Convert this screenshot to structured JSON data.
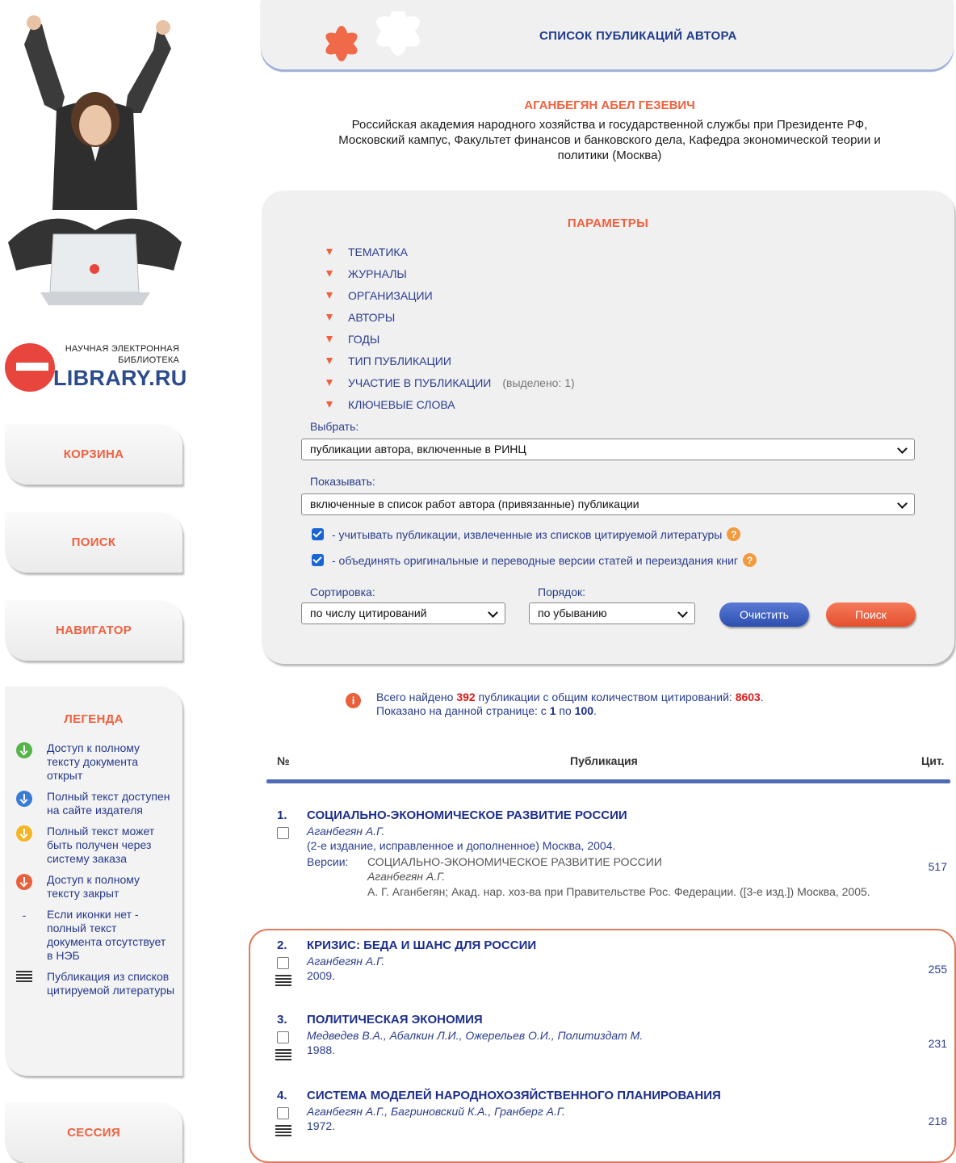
{
  "header": {
    "title": "СПИСОК ПУБЛИКАЦИЙ АВТОРА"
  },
  "logo": {
    "tagline_line1": "НАУЧНАЯ ЭЛЕКТРОННАЯ",
    "tagline_line2": "БИБЛИОТЕКА",
    "brand": "LIBRARY.RU"
  },
  "sidebar": {
    "cart": "КОРЗИНА",
    "search": "ПОИСК",
    "navigator": "НАВИГАТОР",
    "session": "СЕССИЯ"
  },
  "legend": {
    "title": "ЛЕГЕНДА",
    "items": [
      {
        "icon": "green-download-icon",
        "text": "Доступ к полному тексту документа открыт"
      },
      {
        "icon": "blue-download-icon",
        "text": "Полный текст доступен на сайте издателя"
      },
      {
        "icon": "yellow-download-icon",
        "text": "Полный текст может быть получен через систему заказа"
      },
      {
        "icon": "red-download-icon",
        "text": "Доступ к полному тексту закрыт"
      },
      {
        "icon": "dash",
        "symbol": "-",
        "text": "Если иконки нет - полный текст документа отсутствует в НЭБ"
      },
      {
        "icon": "list-icon",
        "text": "Публикация из списков цитируемой литературы"
      }
    ]
  },
  "author": {
    "name": "АГАНБЕГЯН АБЕЛ ГЕЗЕВИЧ",
    "affiliation_line1": "Российская академия народного хозяйства и государственной службы при Президенте РФ,",
    "affiliation_line2": "Московский кампус, Факультет финансов и банковского дела, Кафедра экономической теории и",
    "affiliation_line3": "политики (Москва)"
  },
  "params": {
    "title": "ПАРАМЕТРЫ",
    "filters": [
      "ТЕМАТИКА",
      "ЖУРНАЛЫ",
      "ОРГАНИЗАЦИИ",
      "АВТОРЫ",
      "ГОДЫ",
      "ТИП ПУБЛИКАЦИИ",
      "УЧАСТИЕ В ПУБЛИКАЦИИ",
      "КЛЮЧЕВЫЕ СЛОВА"
    ],
    "participation_note": "(выделено: 1)",
    "select_label": "Выбрать:",
    "select_value": "публикации автора, включенные в РИНЦ",
    "show_label": "Показывать:",
    "show_value": "включенные в список работ автора (привязанные) публикации",
    "check1": "- учитывать публикации, извлеченные из списков цитируемой литературы",
    "check2": "- объединять оригинальные и переводные версии статей и переиздания книг",
    "help_symbol": "?",
    "sort_label": "Сортировка:",
    "sort_value": "по числу цитирований",
    "order_label": "Порядок:",
    "order_value": "по убыванию",
    "clear_button": "Очистить",
    "search_button": "Поиск"
  },
  "summary": {
    "info_symbol": "i",
    "pre_total": "Всего найдено ",
    "total": "392",
    "mid": " публикации с общим количеством цитирований: ",
    "citations": "8603",
    "end": ".",
    "shown_pre": "Показано на данной странице: с ",
    "from": "1",
    "shown_mid": " по ",
    "to": "100",
    "shown_end": "."
  },
  "table": {
    "col_num": "№",
    "col_pub": "Публикация",
    "col_cit": "Цит."
  },
  "publications": [
    {
      "num": "1.",
      "title": "СОЦИАЛЬНО-ЭКОНОМИЧЕСКОЕ РАЗВИТИЕ РОССИИ",
      "authors": "Аганбегян А.Г.",
      "meta": "(2-е издание, исправленное и дополненное) Москва, 2004.",
      "versions_label": "Версии:",
      "version_title": "СОЦИАЛЬНО-ЭКОНОМИЧЕСКОЕ РАЗВИТИЕ РОССИИ",
      "version_authors": "Аганбегян А.Г.",
      "version_meta": "А. Г. Аганбегян; Акад. нар. хоз-ва при Правительстве Рос. Федерации. ([3-е изд.]) Москва, 2005.",
      "citations": "517"
    },
    {
      "num": "2.",
      "title": "КРИЗИС: БЕДА И ШАНС ДЛЯ РОССИИ",
      "authors": "Аганбегян А.Г.",
      "meta": "2009.",
      "citations": "255"
    },
    {
      "num": "3.",
      "title": "ПОЛИТИЧЕСКАЯ ЭКОНОМИЯ",
      "authors": "Медведев В.А., Абалкин Л.И., Ожерельев О.И., Политиздат М.",
      "meta": "1988.",
      "citations": "231"
    },
    {
      "num": "4.",
      "title": "СИСТЕМА МОДЕЛЕЙ НАРОДНОХОЗЯЙСТВЕННОГО ПЛАНИРОВАНИЯ",
      "authors": "Аганбегян А.Г., Багриновский К.А., Гранберг А.Г.",
      "meta": "1972.",
      "citations": "218"
    }
  ],
  "colors": {
    "accent": "#f0603e",
    "link": "#1c2e8c",
    "panel": "#f0f0f0",
    "rule": "#4f6cb4"
  }
}
